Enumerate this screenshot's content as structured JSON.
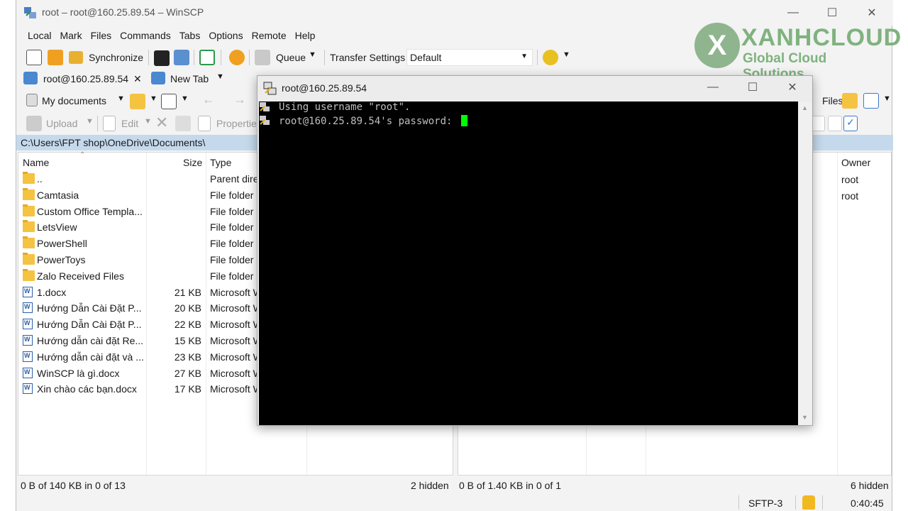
{
  "window": {
    "title": "root – root@160.25.89.54 – WinSCP"
  },
  "menu": [
    "Local",
    "Mark",
    "Files",
    "Commands",
    "Tabs",
    "Options",
    "Remote",
    "Help"
  ],
  "toolbar": {
    "synchronize": "Synchronize",
    "queue": "Queue",
    "transfer_settings": "Transfer Settings",
    "transfer_value": "Default"
  },
  "tabs": {
    "session": "root@160.25.89.54",
    "new_tab": "New Tab"
  },
  "local": {
    "location": "My documents",
    "upload": "Upload",
    "edit": "Edit",
    "properties": "Properties",
    "path": "C:\\Users\\FPT shop\\OneDrive\\Documents\\",
    "columns": {
      "name": "Name",
      "size": "Size",
      "type": "Type"
    },
    "files": [
      {
        "name": "..",
        "size": "",
        "type": "Parent directory",
        "kind": "parent"
      },
      {
        "name": "Camtasia",
        "size": "",
        "type": "File folder",
        "kind": "folder"
      },
      {
        "name": "Custom Office Templa...",
        "size": "",
        "type": "File folder",
        "kind": "folder"
      },
      {
        "name": "LetsView",
        "size": "",
        "type": "File folder",
        "kind": "folder"
      },
      {
        "name": "PowerShell",
        "size": "",
        "type": "File folder",
        "kind": "folder"
      },
      {
        "name": "PowerToys",
        "size": "",
        "type": "File folder",
        "kind": "folder"
      },
      {
        "name": "Zalo Received Files",
        "size": "",
        "type": "File folder",
        "kind": "folder"
      },
      {
        "name": "1.docx",
        "size": "21 KB",
        "type": "Microsoft Word Document",
        "kind": "docx"
      },
      {
        "name": "Hướng Dẫn Cài Đặt P...",
        "size": "20 KB",
        "type": "Microsoft Word Document",
        "kind": "docx"
      },
      {
        "name": "Hướng Dẫn Cài Đặt P...",
        "size": "22 KB",
        "type": "Microsoft Word Document",
        "kind": "docx"
      },
      {
        "name": "Hướng dẫn cài đặt Re...",
        "size": "15 KB",
        "type": "Microsoft Word Document",
        "kind": "docx"
      },
      {
        "name": "Hướng dẫn cài đặt và ...",
        "size": "23 KB",
        "type": "Microsoft Word Document",
        "kind": "docx"
      },
      {
        "name": "WinSCP là gì.docx",
        "size": "27 KB",
        "type": "Microsoft Word Document",
        "kind": "docx"
      },
      {
        "name": "Xin chào các bạn.docx",
        "size": "17 KB",
        "type": "Microsoft Word Document",
        "kind": "docx"
      }
    ],
    "status_left": "0 B of 140 KB in 0 of 13",
    "status_hidden": "2 hidden"
  },
  "remote": {
    "files_label": "Files",
    "columns": {
      "owner": "Owner"
    },
    "owners": [
      "root",
      "root"
    ],
    "status_left": "0 B of 1.40 KB in 0 of 1",
    "status_hidden": "6 hidden"
  },
  "bottom": {
    "protocol": "SFTP-3",
    "time": "0:40:45"
  },
  "terminal": {
    "title": "root@160.25.89.54",
    "line1": "Using username \"root\".",
    "line2": "root@160.25.89.54's password: "
  },
  "logo": {
    "brand": "XANHCLOUD",
    "tagline": "Global Cloud Solutions",
    "mark": "X"
  },
  "colors": {
    "path_bar": "#c5d9ec",
    "cursor": "#00ff00",
    "logo": "#7fb27f"
  }
}
